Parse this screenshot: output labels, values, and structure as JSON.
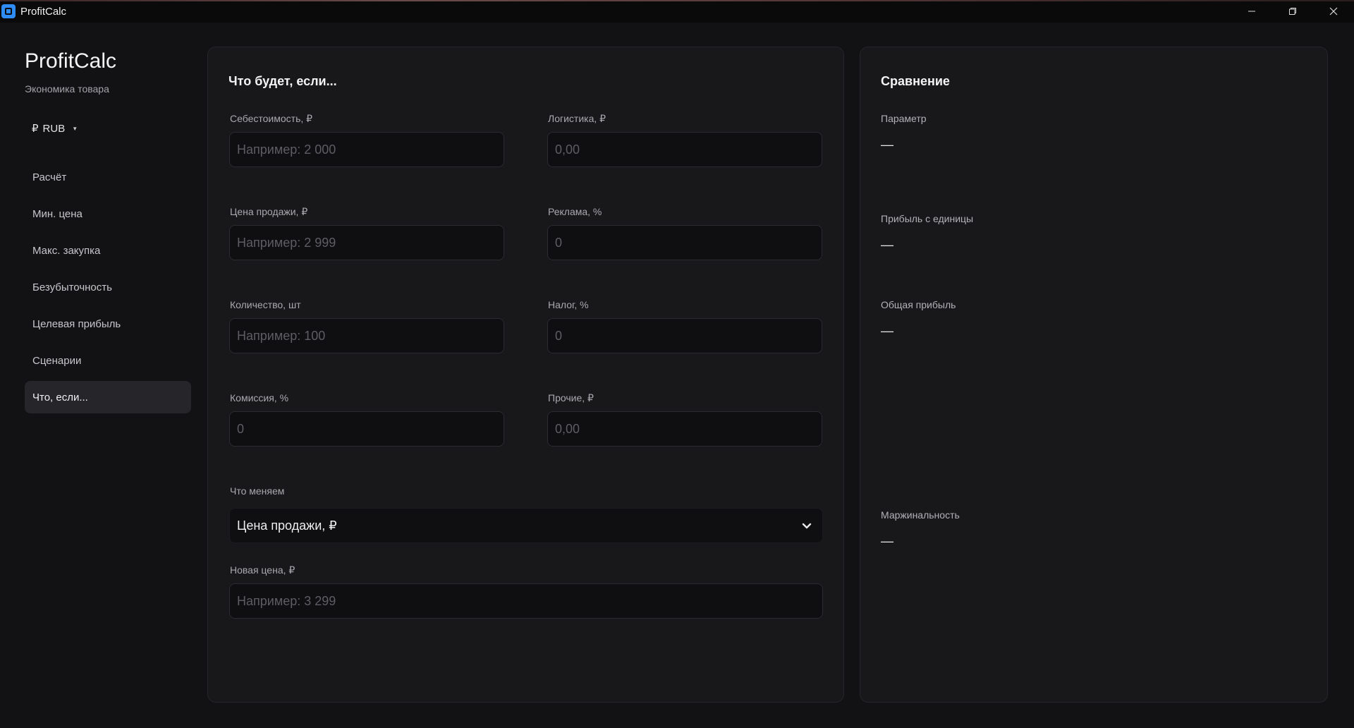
{
  "window": {
    "title": "ProfitCalc"
  },
  "sidebar": {
    "brand": "ProfitCalc",
    "subtitle": "Экономика товара",
    "currency": {
      "symbol": "₽",
      "code": "RUB"
    },
    "items": [
      {
        "label": "Расчёт"
      },
      {
        "label": "Мин. цена"
      },
      {
        "label": "Макс. закупка"
      },
      {
        "label": "Безубыточность"
      },
      {
        "label": "Целевая прибыль"
      },
      {
        "label": "Сценарии"
      },
      {
        "label": "Что, если..."
      }
    ],
    "active_index": 6
  },
  "form": {
    "title": "Что будет, если...",
    "cost": {
      "label": "Себестоимость, ₽",
      "value": "",
      "placeholder": "Например: 2 000"
    },
    "logistics": {
      "label": "Логистика, ₽",
      "value": "",
      "placeholder": "0,00"
    },
    "price": {
      "label": "Цена продажи, ₽",
      "value": "",
      "placeholder": "Например: 2 999"
    },
    "ads": {
      "label": "Реклама, %",
      "value": "",
      "placeholder": "0"
    },
    "quantity": {
      "label": "Количество, шт",
      "value": "",
      "placeholder": "Например: 100"
    },
    "tax": {
      "label": "Налог, %",
      "value": "",
      "placeholder": "0"
    },
    "commission": {
      "label": "Комиссия, %",
      "value": "",
      "placeholder": "0"
    },
    "other": {
      "label": "Прочие, ₽",
      "value": "",
      "placeholder": "0,00"
    },
    "change": {
      "label": "Что меняем",
      "selected": "Цена продажи, ₽"
    },
    "new_price": {
      "label": "Новая цена, ₽",
      "value": "",
      "placeholder": "Например: 3 299"
    }
  },
  "comparison": {
    "title": "Сравнение",
    "rows": [
      {
        "label": "Параметр",
        "value": "—"
      },
      {
        "label": "Прибыль с единицы",
        "value": "—"
      },
      {
        "label": "Общая прибыль",
        "value": "—"
      },
      {
        "label": "Маржинальность",
        "value": "—"
      }
    ]
  },
  "colors": {
    "background": "#121214",
    "card": "#18181b",
    "input": "#0f0f11",
    "active_nav": "#26262a",
    "logo_accent": "#2f8cf5"
  }
}
